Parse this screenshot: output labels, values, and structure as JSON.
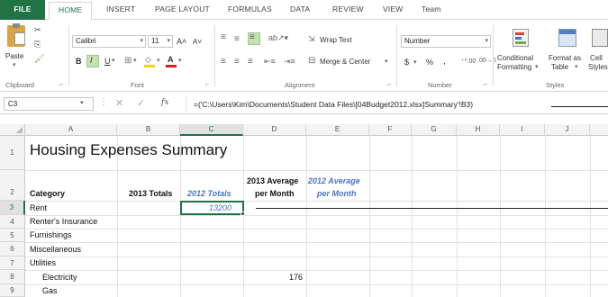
{
  "ribbon_tabs": [
    "FILE",
    "HOME",
    "INSERT",
    "PAGE LAYOUT",
    "FORMULAS",
    "DATA",
    "REVIEW",
    "VIEW",
    "Team"
  ],
  "clipboard": {
    "paste_label": "Paste",
    "group_label": "Clipboard"
  },
  "font": {
    "name": "Calibri",
    "size": "11",
    "group_label": "Font"
  },
  "alignment": {
    "wrap_text": "Wrap Text",
    "merge_center": "Merge & Center",
    "group_label": "Alignment"
  },
  "number": {
    "format": "Number",
    "currency": "$",
    "percent": "%",
    "comma": ",",
    "group_label": "Number"
  },
  "styles": {
    "conditional": "Conditional",
    "formatting": "Formatting",
    "format_as": "Format as",
    "table": "Table",
    "cell": "Cell",
    "cell_styles": "Styles",
    "group_label": "Styles"
  },
  "formula_bar": {
    "name_box": "C3",
    "fx": "fx",
    "formula": "=('C:\\Users\\Kim\\Documents\\Student Data Files\\[04Budget2012.xlsx]Summary'!B3)"
  },
  "columns": [
    "A",
    "B",
    "C",
    "D",
    "E",
    "F",
    "G",
    "H",
    "I",
    "J"
  ],
  "rows": [
    "1",
    "2",
    "3",
    "4",
    "5",
    "6",
    "7",
    "8",
    "9"
  ],
  "sheet": {
    "title": "Housing Expenses Summary",
    "header_category": "Category",
    "header_2013_totals": "2013 Totals",
    "header_2012_totals": "2012 Totals",
    "header_2013_avg_line1": "2013 Average",
    "header_2013_avg_line2": "per Month",
    "header_2012_avg_line1": "2012 Average",
    "header_2012_avg_line2": "per Month",
    "categories": [
      "Rent",
      "Renter's Insurance",
      "Furnishings",
      "Miscellaneous",
      "Utilities",
      "Electricity",
      "Gas"
    ],
    "rent_2012_total": "13200",
    "electricity_2013_avg": "176"
  },
  "colors": {
    "accent": "#217346",
    "italic_header": "#4a74c4"
  }
}
